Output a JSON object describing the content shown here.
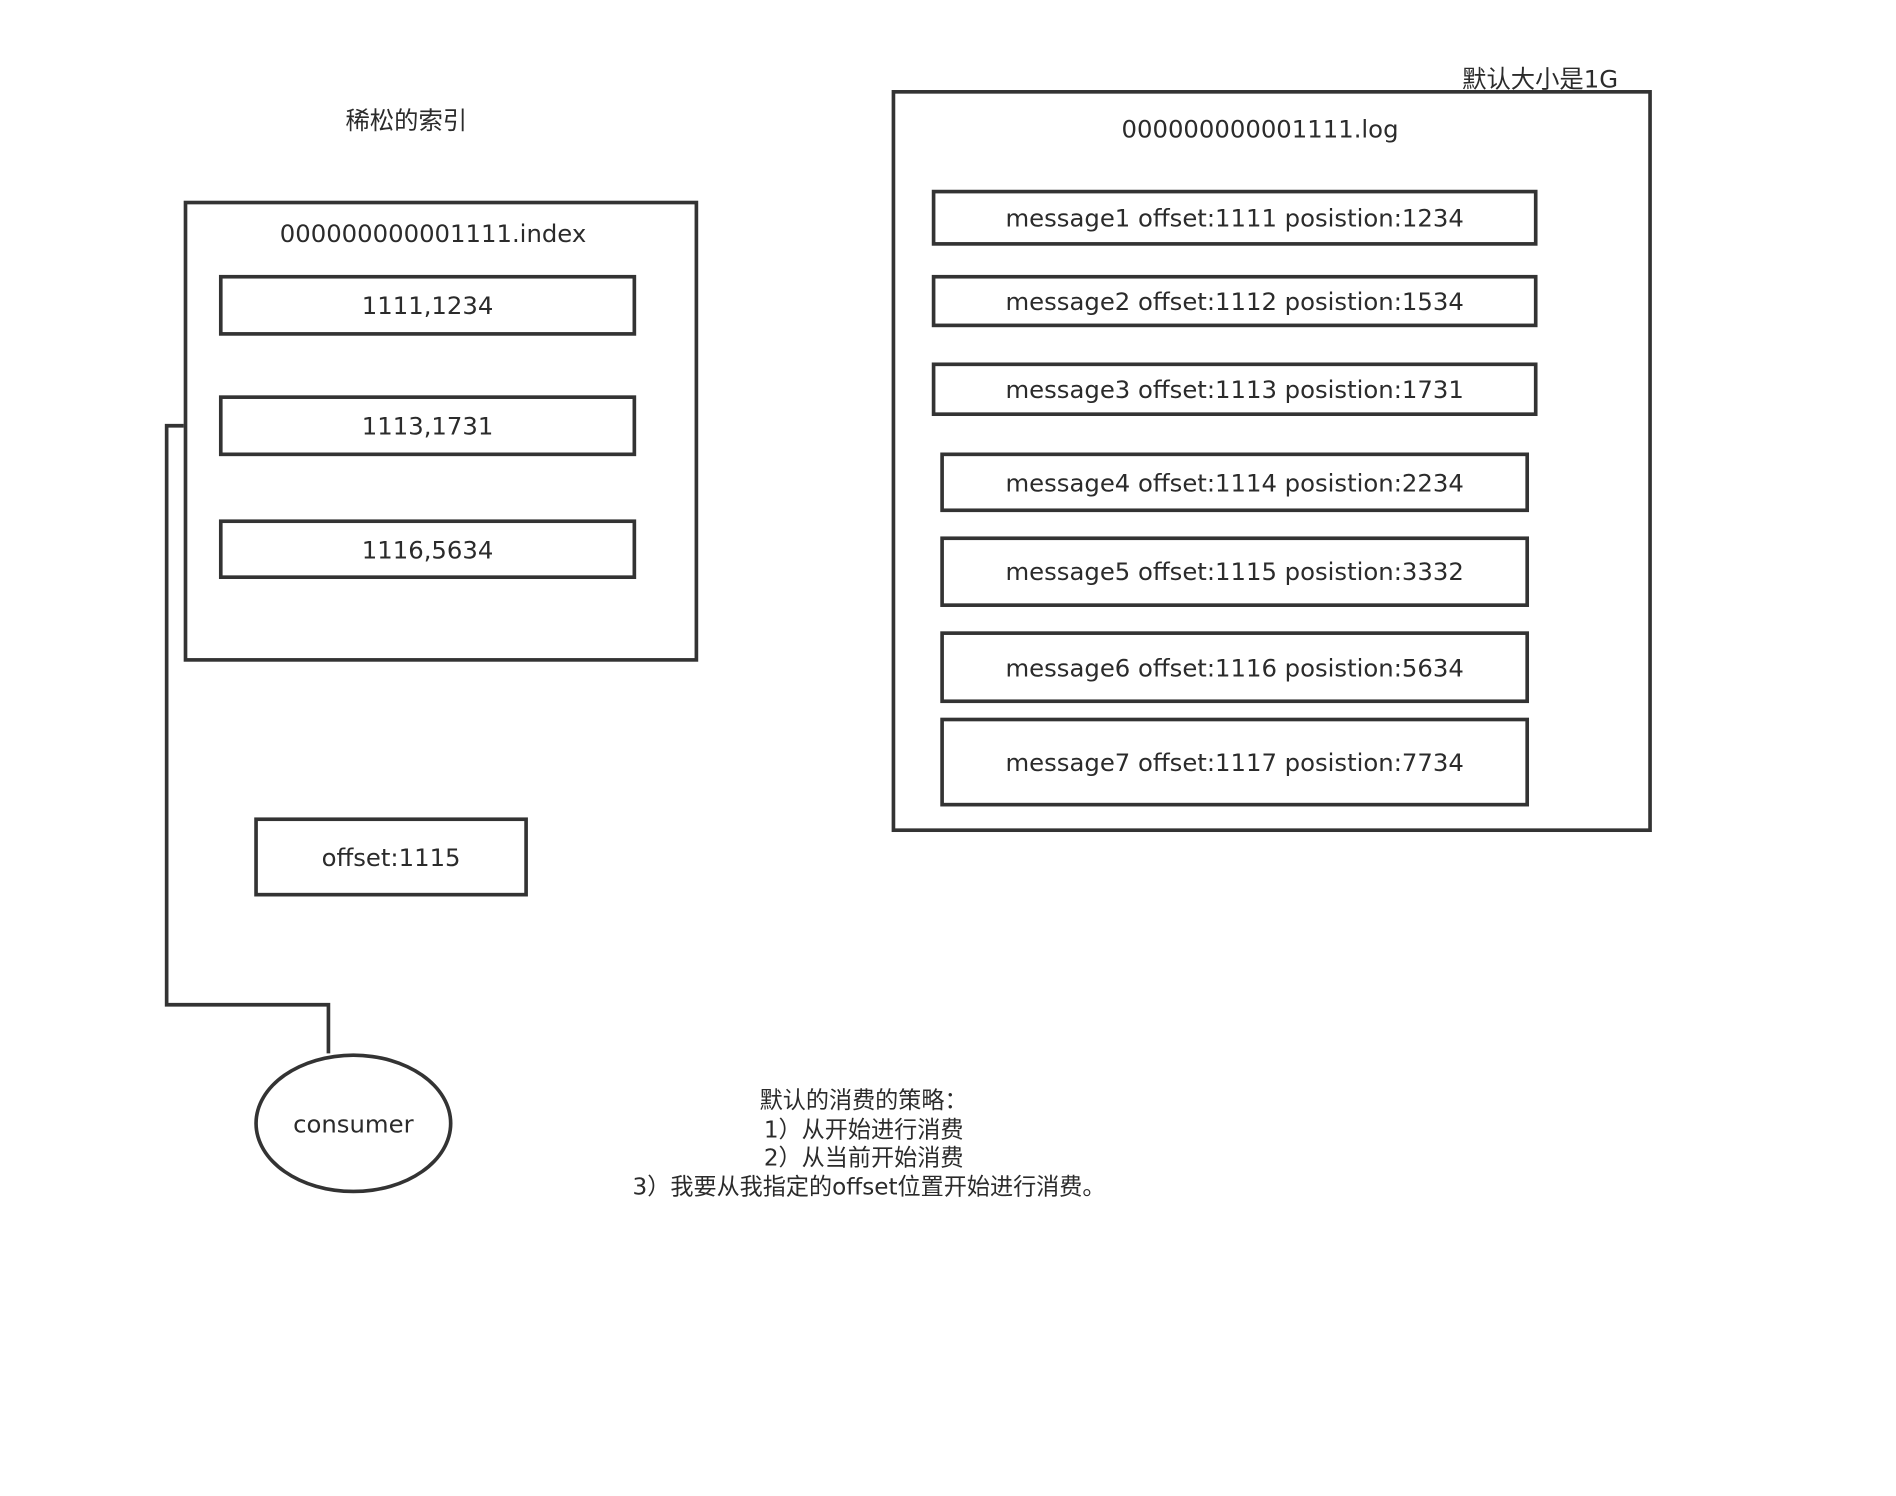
{
  "index_title": "稀松的索引",
  "index_file": {
    "filename": "000000000001111.index",
    "entries": [
      "1111,1234",
      "1113,1731",
      "1116,5634"
    ]
  },
  "log_size_label": "默认大小是1G",
  "log_file": {
    "filename": "000000000001111.log",
    "messages": [
      "message1  offset:1111  posistion:1234",
      "message2  offset:1112  posistion:1534",
      "message3  offset:1113  posistion:1731",
      "message4  offset:1114  posistion:2234",
      "message5  offset:1115  posistion:3332",
      "message6  offset:1116  posistion:5634",
      "message7  offset:1117  posistion:7734"
    ]
  },
  "offset_box": "offset:1115",
  "consumer": "consumer",
  "strategy": {
    "title": "默认的消费的策略：",
    "lines": [
      "1）从开始进行消费",
      "2）从当前开始消费",
      "3）我要从我指定的offset位置开始进行消费。"
    ]
  }
}
